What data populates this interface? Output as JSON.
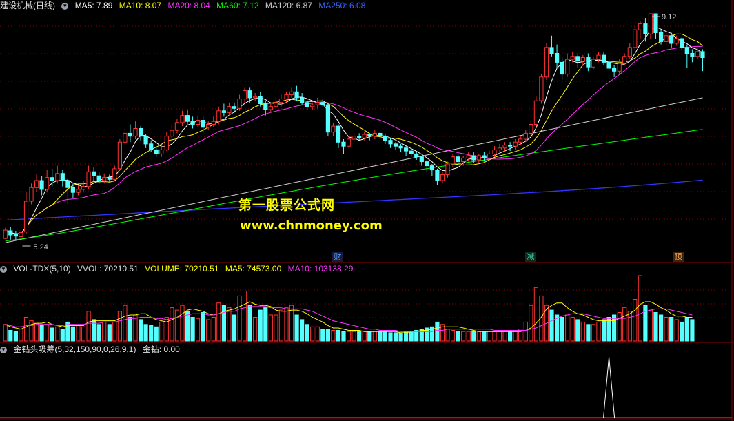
{
  "main_header": {
    "title": "建设机械(日线)",
    "ma5": "MA5: 7.89",
    "ma10": "MA10: 8.07",
    "ma20": "MA20: 8.04",
    "ma60": "MA60: 7.12",
    "ma120": "MA120: 6.87",
    "ma250": "MA250: 6.08"
  },
  "vol_header": {
    "name": "VOL-TDX(5,10)",
    "vvol": "VVOL: 70210.51",
    "volume": "VOLUME: 70210.51",
    "ma5": "MA5: 74573.00",
    "ma10": "MA10: 103138.29"
  },
  "ind_header": {
    "name": "金钻头吸筹(5,32,150,90,0,26,9,1)",
    "value": "金钻: 0.00"
  },
  "annotations": {
    "high": "9.12",
    "low": "5.24"
  },
  "watermark": {
    "line1": "第一股票公式网",
    "line2": "www.chnmoney.com"
  },
  "event_markers": [
    {
      "label": "财",
      "color": "#5aa0ff"
    },
    {
      "label": "减",
      "color": "#3fd0a0"
    },
    {
      "label": "预",
      "color": "#ffa64d"
    }
  ],
  "colors": {
    "up": "#ff3333",
    "down": "#54ffff",
    "ma5": "#ffffff",
    "ma10": "#ffff00",
    "ma20": "#ff33ff",
    "ma60": "#00ff00",
    "ma120": "#d0d0d0",
    "ma250": "#3333ff"
  },
  "chart_data": {
    "type": "candlestick",
    "price_range": [
      5.24,
      9.12
    ],
    "candles": [
      [
        5.32,
        5.46,
        5.31,
        5.5
      ],
      [
        5.45,
        5.38,
        5.3,
        5.52
      ],
      [
        5.4,
        5.36,
        5.28,
        5.45
      ],
      [
        5.35,
        5.42,
        5.24,
        5.46
      ],
      [
        5.43,
        5.95,
        5.4,
        6.1
      ],
      [
        5.95,
        6.18,
        5.9,
        6.25
      ],
      [
        6.18,
        6.3,
        6.1,
        6.4
      ],
      [
        6.3,
        6.15,
        6.05,
        6.38
      ],
      [
        6.15,
        6.35,
        6.1,
        6.48
      ],
      [
        6.35,
        6.3,
        6.2,
        6.5
      ],
      [
        6.3,
        6.42,
        6.25,
        6.55
      ],
      [
        6.42,
        6.3,
        6.2,
        6.48
      ],
      [
        6.3,
        6.18,
        5.9,
        6.35
      ],
      [
        6.18,
        6.1,
        6.0,
        6.25
      ],
      [
        6.1,
        6.15,
        6.05,
        6.22
      ],
      [
        6.15,
        6.2,
        6.1,
        6.3
      ],
      [
        6.2,
        6.45,
        6.15,
        6.55
      ],
      [
        6.45,
        6.38,
        6.3,
        6.52
      ],
      [
        6.38,
        6.3,
        6.25,
        6.45
      ],
      [
        6.3,
        6.35,
        6.25,
        6.42
      ],
      [
        6.35,
        6.32,
        6.28,
        6.4
      ],
      [
        6.32,
        6.5,
        6.3,
        6.55
      ],
      [
        6.5,
        6.95,
        6.48,
        7.0
      ],
      [
        6.95,
        7.1,
        6.85,
        7.2
      ],
      [
        7.1,
        7.05,
        6.95,
        7.25
      ],
      [
        7.05,
        7.18,
        7.0,
        7.3
      ],
      [
        7.18,
        7.05,
        6.98,
        7.22
      ],
      [
        7.05,
        6.92,
        6.85,
        7.08
      ],
      [
        6.92,
        6.82,
        6.78,
        6.98
      ],
      [
        6.82,
        6.75,
        6.7,
        6.88
      ],
      [
        6.75,
        6.82,
        6.7,
        6.9
      ],
      [
        6.82,
        7.05,
        6.8,
        7.12
      ],
      [
        7.05,
        7.15,
        7.0,
        7.25
      ],
      [
        7.15,
        7.28,
        7.1,
        7.35
      ],
      [
        7.28,
        7.4,
        7.22,
        7.48
      ],
      [
        7.4,
        7.3,
        7.25,
        7.5
      ],
      [
        7.3,
        7.25,
        7.18,
        7.38
      ],
      [
        7.25,
        7.32,
        7.2,
        7.4
      ],
      [
        7.32,
        7.2,
        7.12,
        7.38
      ],
      [
        7.2,
        7.25,
        7.15,
        7.3
      ],
      [
        7.25,
        7.3,
        7.2,
        7.38
      ],
      [
        7.3,
        7.48,
        7.25,
        7.55
      ],
      [
        7.48,
        7.45,
        7.38,
        7.6
      ],
      [
        7.45,
        7.55,
        7.4,
        7.62
      ],
      [
        7.55,
        7.52,
        7.45,
        7.62
      ],
      [
        7.52,
        7.68,
        7.48,
        7.75
      ],
      [
        7.68,
        7.82,
        7.6,
        7.88
      ],
      [
        7.82,
        7.7,
        7.62,
        7.88
      ],
      [
        7.7,
        7.72,
        7.65,
        7.78
      ],
      [
        7.72,
        7.6,
        7.55,
        7.8
      ],
      [
        7.6,
        7.5,
        7.4,
        7.65
      ],
      [
        7.5,
        7.55,
        7.45,
        7.6
      ],
      [
        7.55,
        7.62,
        7.5,
        7.7
      ],
      [
        7.62,
        7.68,
        7.55,
        7.75
      ],
      [
        7.68,
        7.75,
        7.62,
        7.8
      ],
      [
        7.75,
        7.8,
        7.7,
        7.88
      ],
      [
        7.8,
        7.7,
        7.65,
        7.9
      ],
      [
        7.7,
        7.62,
        7.58,
        7.78
      ],
      [
        7.62,
        7.55,
        7.5,
        7.68
      ],
      [
        7.55,
        7.58,
        7.5,
        7.62
      ],
      [
        7.58,
        7.62,
        7.52,
        7.7
      ],
      [
        7.62,
        7.58,
        7.55,
        7.68
      ],
      [
        7.58,
        7.12,
        7.05,
        7.6
      ],
      [
        7.12,
        7.22,
        7.05,
        7.28
      ],
      [
        7.22,
        6.95,
        6.85,
        7.25
      ],
      [
        6.95,
        6.88,
        6.75,
        7.0
      ],
      [
        6.88,
        7.0,
        6.85,
        7.05
      ],
      [
        7.0,
        7.05,
        6.95,
        7.1
      ],
      [
        7.05,
        7.02,
        6.98,
        7.1
      ],
      [
        7.02,
        7.08,
        6.98,
        7.12
      ],
      [
        7.08,
        7.05,
        6.98,
        7.1
      ],
      [
        7.05,
        7.1,
        7.0,
        7.15
      ],
      [
        7.1,
        7.05,
        7.0,
        7.12
      ],
      [
        7.05,
        6.98,
        6.92,
        7.08
      ],
      [
        6.98,
        6.92,
        6.85,
        7.02
      ],
      [
        6.92,
        6.88,
        6.82,
        6.95
      ],
      [
        6.88,
        6.85,
        6.78,
        6.92
      ],
      [
        6.85,
        6.8,
        6.72,
        6.88
      ],
      [
        6.8,
        6.75,
        6.7,
        6.82
      ],
      [
        6.75,
        6.7,
        6.65,
        6.78
      ],
      [
        6.7,
        6.62,
        6.55,
        6.72
      ],
      [
        6.62,
        6.55,
        6.45,
        6.65
      ],
      [
        6.55,
        6.48,
        6.38,
        6.58
      ],
      [
        6.48,
        6.3,
        6.22,
        6.5
      ],
      [
        6.3,
        6.4,
        6.25,
        6.45
      ],
      [
        6.4,
        6.58,
        6.35,
        6.62
      ],
      [
        6.58,
        6.7,
        6.52,
        6.75
      ],
      [
        6.7,
        6.62,
        6.58,
        6.75
      ],
      [
        6.62,
        6.68,
        6.55,
        6.72
      ],
      [
        6.68,
        6.72,
        6.62,
        6.78
      ],
      [
        6.72,
        6.65,
        6.6,
        6.78
      ],
      [
        6.65,
        6.72,
        6.6,
        6.75
      ],
      [
        6.72,
        6.68,
        6.62,
        6.78
      ],
      [
        6.68,
        6.75,
        6.65,
        6.8
      ],
      [
        6.75,
        6.82,
        6.7,
        6.88
      ],
      [
        6.82,
        6.85,
        6.75,
        6.92
      ],
      [
        6.85,
        6.9,
        6.8,
        6.95
      ],
      [
        6.9,
        6.88,
        6.8,
        6.95
      ],
      [
        6.88,
        6.95,
        6.82,
        7.0
      ],
      [
        6.95,
        7.0,
        6.9,
        7.05
      ],
      [
        7.0,
        7.1,
        6.95,
        7.15
      ],
      [
        7.1,
        7.25,
        7.05,
        7.3
      ],
      [
        7.25,
        7.65,
        7.2,
        7.72
      ],
      [
        7.65,
        8.05,
        7.6,
        8.1
      ],
      [
        8.05,
        8.55,
        8.0,
        8.62
      ],
      [
        8.55,
        8.45,
        8.4,
        8.75
      ],
      [
        8.45,
        8.3,
        8.2,
        8.6
      ],
      [
        8.3,
        8.1,
        8.0,
        8.4
      ],
      [
        8.1,
        8.35,
        8.05,
        8.45
      ],
      [
        8.35,
        8.4,
        8.3,
        8.48
      ],
      [
        8.4,
        8.32,
        8.2,
        8.45
      ],
      [
        8.32,
        8.38,
        8.25,
        8.42
      ],
      [
        8.38,
        8.22,
        8.15,
        8.45
      ],
      [
        8.22,
        8.35,
        8.18,
        8.4
      ],
      [
        8.35,
        8.42,
        8.3,
        8.48
      ],
      [
        8.42,
        8.3,
        8.25,
        8.48
      ],
      [
        8.3,
        8.2,
        8.15,
        8.35
      ],
      [
        8.2,
        8.15,
        8.05,
        8.25
      ],
      [
        8.15,
        8.28,
        8.1,
        8.35
      ],
      [
        8.28,
        8.4,
        8.25,
        8.45
      ],
      [
        8.4,
        8.55,
        8.35,
        8.62
      ],
      [
        8.55,
        8.85,
        8.5,
        8.92
      ],
      [
        8.85,
        8.95,
        8.7,
        9.0
      ],
      [
        8.95,
        8.78,
        8.65,
        9.05
      ],
      [
        8.78,
        9.12,
        8.7,
        9.12
      ],
      [
        9.12,
        8.8,
        8.7,
        9.12
      ],
      [
        8.8,
        8.65,
        8.6,
        8.85
      ],
      [
        8.65,
        8.75,
        8.6,
        8.82
      ],
      [
        8.75,
        8.62,
        8.55,
        8.8
      ],
      [
        8.62,
        8.7,
        8.58,
        8.75
      ],
      [
        8.7,
        8.55,
        8.5,
        8.72
      ],
      [
        8.55,
        8.45,
        8.2,
        8.6
      ],
      [
        8.45,
        8.4,
        8.3,
        8.52
      ],
      [
        8.4,
        8.48,
        8.35,
        8.55
      ],
      [
        8.48,
        8.38,
        8.15,
        8.52
      ]
    ],
    "volume": [
      14,
      9,
      8,
      10,
      20,
      17,
      15,
      13,
      14,
      11,
      12,
      10,
      16,
      12,
      13,
      12,
      25,
      18,
      14,
      16,
      14,
      16,
      25,
      30,
      20,
      22,
      18,
      14,
      13,
      12,
      16,
      20,
      28,
      26,
      30,
      25,
      20,
      19,
      24,
      18,
      20,
      32,
      30,
      28,
      22,
      38,
      42,
      30,
      20,
      26,
      28,
      22,
      22,
      26,
      28,
      30,
      22,
      18,
      14,
      12,
      12,
      10,
      10,
      9,
      9,
      8,
      8,
      8,
      8,
      8,
      8,
      8,
      8,
      8,
      7,
      7,
      7,
      8,
      8,
      9,
      10,
      11,
      12,
      16,
      14,
      10,
      9,
      8,
      8,
      8,
      8,
      8,
      8,
      8,
      8,
      8,
      8,
      8,
      9,
      10,
      16,
      30,
      45,
      38,
      30,
      26,
      22,
      20,
      22,
      20,
      18,
      16,
      14,
      14,
      16,
      18,
      20,
      22,
      24,
      28,
      25,
      35,
      55,
      30,
      26,
      24,
      22,
      20,
      20,
      18,
      16,
      20,
      18
    ],
    "vol_ma5": [
      14,
      12,
      11,
      10,
      12,
      14,
      15,
      15,
      16,
      14,
      13,
      12,
      13,
      13,
      13,
      13,
      16,
      17,
      17,
      17,
      17,
      17,
      19,
      21,
      22,
      22,
      23,
      23,
      20,
      18,
      17,
      16,
      18,
      20,
      23,
      26,
      27,
      26,
      25,
      23,
      22,
      23,
      25,
      26,
      27,
      29,
      31,
      33,
      31,
      30,
      30,
      29,
      26,
      25,
      25,
      26,
      26,
      25,
      23,
      20,
      18,
      16,
      13,
      11,
      11,
      10,
      9,
      9,
      9,
      8,
      8,
      8,
      8,
      8,
      8,
      8,
      7,
      7,
      8,
      8,
      9,
      9,
      10,
      11,
      12,
      12,
      12,
      12,
      11,
      10,
      9,
      8,
      8,
      8,
      8,
      8,
      8,
      8,
      8,
      8,
      9,
      11,
      15,
      20,
      27,
      30,
      32,
      32,
      28,
      25,
      23,
      22,
      20,
      18,
      17,
      17,
      17,
      17,
      19,
      21,
      23,
      26,
      31,
      33,
      33,
      31,
      28,
      26,
      23,
      21,
      21,
      20,
      20
    ],
    "vol_ma10": [
      14,
      13,
      12,
      12,
      13,
      13,
      14,
      14,
      14,
      14,
      13,
      13,
      14,
      14,
      14,
      14,
      15,
      15,
      15,
      16,
      16,
      16,
      17,
      18,
      19,
      19,
      20,
      20,
      20,
      19,
      19,
      18,
      19,
      20,
      21,
      22,
      23,
      23,
      23,
      22,
      22,
      23,
      24,
      25,
      25,
      27,
      28,
      29,
      29,
      29,
      29,
      28,
      28,
      28,
      27,
      27,
      27,
      27,
      26,
      25,
      23,
      21,
      19,
      17,
      16,
      15,
      14,
      13,
      12,
      11,
      10,
      10,
      9,
      9,
      9,
      9,
      8,
      8,
      8,
      8,
      8,
      8,
      8,
      9,
      9,
      10,
      10,
      10,
      10,
      10,
      10,
      10,
      10,
      10,
      9,
      9,
      9,
      9,
      9,
      9,
      9,
      10,
      11,
      13,
      15,
      17,
      19,
      21,
      22,
      23,
      23,
      23,
      22,
      21,
      20,
      19,
      19,
      19,
      19,
      19,
      20,
      21,
      23,
      25,
      26,
      27,
      27,
      27,
      26,
      25,
      24,
      23,
      22
    ],
    "signal_index": 119,
    "signal_value": 1,
    "moving_averages": [
      "MA5",
      "MA10",
      "MA20",
      "MA60",
      "MA120",
      "MA250"
    ]
  }
}
